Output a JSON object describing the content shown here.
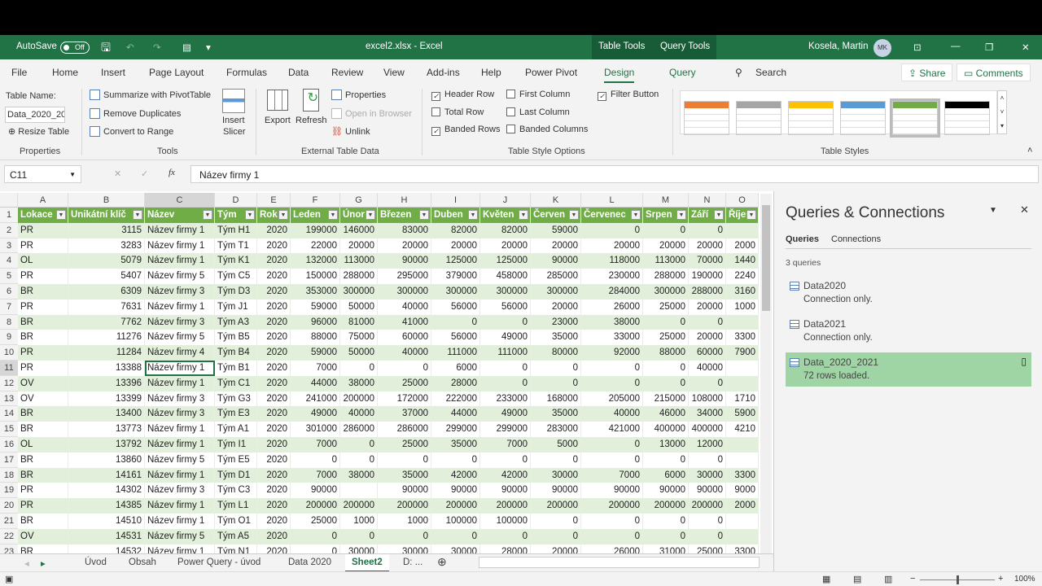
{
  "titlebar": {
    "autosave": "AutoSave",
    "toggle": "Off",
    "filename": "excel2.xlsx  -  Excel",
    "ctx1": "Table Tools",
    "ctx2": "Query Tools",
    "user": "Kosela, Martin",
    "initials": "MK"
  },
  "menu": {
    "tabs": [
      "File",
      "Home",
      "Insert",
      "Page Layout",
      "Formulas",
      "Data",
      "Review",
      "View",
      "Add-ins",
      "Help",
      "Power Pivot",
      "Design",
      "Query"
    ],
    "active": "Design",
    "search": "Search",
    "share": "Share",
    "comments": "Comments"
  },
  "ribbon": {
    "properties": {
      "label": "Table Name:",
      "value": "Data_2020_202",
      "resize": "Resize Table",
      "group": "Properties"
    },
    "tools": {
      "pivot": "Summarize with PivotTable",
      "dupes": "Remove Duplicates",
      "convert": "Convert to Range",
      "slicer1": "Insert",
      "slicer2": "Slicer",
      "group": "Tools"
    },
    "external": {
      "export": "Export",
      "refresh": "Refresh",
      "properties": "Properties",
      "browser": "Open in Browser",
      "unlink": "Unlink",
      "group": "External Table Data"
    },
    "options": {
      "header_row": "Header Row",
      "total_row": "Total Row",
      "banded_rows": "Banded Rows",
      "first_col": "First Column",
      "last_col": "Last Column",
      "banded_cols": "Banded Columns",
      "filter": "Filter Button",
      "group": "Table Style Options",
      "checked": {
        "header_row": true,
        "total_row": false,
        "banded_rows": true,
        "first_col": false,
        "last_col": false,
        "banded_cols": false,
        "filter": true
      }
    },
    "styles": {
      "group": "Table Styles",
      "colors": [
        "#ed7d31",
        "#a5a5a5",
        "#ffc000",
        "#5b9bd5",
        "#70ad47",
        "#000000"
      ],
      "selected": 4
    }
  },
  "formula": {
    "cellref": "C11",
    "fx": "fx",
    "value": "Název firmy 1"
  },
  "grid": {
    "columns": [
      "A",
      "B",
      "C",
      "D",
      "E",
      "F",
      "G",
      "H",
      "I",
      "J",
      "K",
      "L",
      "M",
      "N",
      "O"
    ],
    "headers": [
      "Lokace",
      "Unikátní klíč",
      "Název",
      "Tým",
      "Rok",
      "Leden",
      "Únor",
      "Březen",
      "Duben",
      "Květen",
      "Červen",
      "Červenec",
      "Srpen",
      "Září",
      "Říjen"
    ],
    "rows": [
      [
        "PR",
        "3115",
        "Název firmy 1",
        "Tým H1",
        "2020",
        "199000",
        "146000",
        "83000",
        "82000",
        "82000",
        "59000",
        "0",
        "0",
        "0",
        ""
      ],
      [
        "PR",
        "3283",
        "Název firmy 1",
        "Tým T1",
        "2020",
        "22000",
        "20000",
        "20000",
        "20000",
        "20000",
        "20000",
        "20000",
        "20000",
        "20000",
        "2000"
      ],
      [
        "OL",
        "5079",
        "Název firmy 1",
        "Tým K1",
        "2020",
        "132000",
        "113000",
        "90000",
        "125000",
        "125000",
        "90000",
        "118000",
        "113000",
        "70000",
        "1440"
      ],
      [
        "PR",
        "5407",
        "Název firmy 5",
        "Tým C5",
        "2020",
        "150000",
        "288000",
        "295000",
        "379000",
        "458000",
        "285000",
        "230000",
        "288000",
        "190000",
        "2240"
      ],
      [
        "BR",
        "6309",
        "Název firmy 3",
        "Tým D3",
        "2020",
        "353000",
        "300000",
        "300000",
        "300000",
        "300000",
        "300000",
        "284000",
        "300000",
        "288000",
        "3160"
      ],
      [
        "PR",
        "7631",
        "Název firmy 1",
        "Tým J1",
        "2020",
        "59000",
        "50000",
        "40000",
        "56000",
        "56000",
        "20000",
        "26000",
        "25000",
        "20000",
        "1000"
      ],
      [
        "BR",
        "7762",
        "Název firmy 3",
        "Tým A3",
        "2020",
        "96000",
        "81000",
        "41000",
        "0",
        "0",
        "23000",
        "38000",
        "0",
        "0",
        ""
      ],
      [
        "BR",
        "11276",
        "Název firmy 5",
        "Tým B5",
        "2020",
        "88000",
        "75000",
        "60000",
        "56000",
        "49000",
        "35000",
        "33000",
        "25000",
        "20000",
        "3300"
      ],
      [
        "PR",
        "11284",
        "Název firmy 4",
        "Tým B4",
        "2020",
        "59000",
        "50000",
        "40000",
        "111000",
        "111000",
        "80000",
        "92000",
        "88000",
        "60000",
        "7900"
      ],
      [
        "PR",
        "13388",
        "Název firmy 1",
        "Tým B1",
        "2020",
        "7000",
        "0",
        "0",
        "6000",
        "0",
        "0",
        "0",
        "0",
        "40000",
        ""
      ],
      [
        "OV",
        "13396",
        "Název firmy 1",
        "Tým C1",
        "2020",
        "44000",
        "38000",
        "25000",
        "28000",
        "0",
        "0",
        "0",
        "0",
        "0",
        ""
      ],
      [
        "OV",
        "13399",
        "Název firmy 3",
        "Tým G3",
        "2020",
        "241000",
        "200000",
        "172000",
        "222000",
        "233000",
        "168000",
        "205000",
        "215000",
        "108000",
        "1710"
      ],
      [
        "BR",
        "13400",
        "Název firmy 3",
        "Tým E3",
        "2020",
        "49000",
        "40000",
        "37000",
        "44000",
        "49000",
        "35000",
        "40000",
        "46000",
        "34000",
        "5900"
      ],
      [
        "BR",
        "13773",
        "Název firmy 1",
        "Tým A1",
        "2020",
        "301000",
        "286000",
        "286000",
        "299000",
        "299000",
        "283000",
        "421000",
        "400000",
        "400000",
        "4210"
      ],
      [
        "OL",
        "13792",
        "Název firmy 1",
        "Tým I1",
        "2020",
        "7000",
        "0",
        "25000",
        "35000",
        "7000",
        "5000",
        "0",
        "13000",
        "12000",
        ""
      ],
      [
        "BR",
        "13860",
        "Název firmy 5",
        "Tým E5",
        "2020",
        "0",
        "0",
        "0",
        "0",
        "0",
        "0",
        "0",
        "0",
        "0",
        ""
      ],
      [
        "BR",
        "14161",
        "Název firmy 1",
        "Tým D1",
        "2020",
        "7000",
        "38000",
        "35000",
        "42000",
        "42000",
        "30000",
        "7000",
        "6000",
        "30000",
        "3300"
      ],
      [
        "PR",
        "14302",
        "Název firmy 3",
        "Tým C3",
        "2020",
        "90000",
        "",
        "90000",
        "90000",
        "90000",
        "90000",
        "90000",
        "90000",
        "90000",
        "9000"
      ],
      [
        "PR",
        "14385",
        "Název firmy 1",
        "Tým L1",
        "2020",
        "200000",
        "200000",
        "200000",
        "200000",
        "200000",
        "200000",
        "200000",
        "200000",
        "200000",
        "2000"
      ],
      [
        "BR",
        "14510",
        "Název firmy 1",
        "Tým O1",
        "2020",
        "25000",
        "1000",
        "1000",
        "100000",
        "100000",
        "0",
        "0",
        "0",
        "0",
        ""
      ],
      [
        "OV",
        "14531",
        "Název firmy 5",
        "Tým A5",
        "2020",
        "0",
        "0",
        "0",
        "0",
        "0",
        "0",
        "0",
        "0",
        "0",
        ""
      ],
      [
        "BR",
        "14532",
        "Název firmy 1",
        "Tým N1",
        "2020",
        "0",
        "30000",
        "30000",
        "30000",
        "28000",
        "20000",
        "26000",
        "31000",
        "25000",
        "3300"
      ]
    ],
    "selected_cell": "C11"
  },
  "sheets": {
    "tabs": [
      "Úvod",
      "Obsah",
      "Power Query - úvod",
      "Data 2020",
      "Sheet2",
      "D: ..."
    ],
    "active": "Sheet2"
  },
  "pane": {
    "title": "Queries & Connections",
    "tabs": [
      "Queries",
      "Connections"
    ],
    "count": "3 queries",
    "queries": [
      {
        "name": "Data2020",
        "status": "Connection only."
      },
      {
        "name": "Data2021",
        "status": "Connection only."
      },
      {
        "name": "Data_2020_2021",
        "status": "72 rows loaded."
      }
    ],
    "active_query": 2
  },
  "status": {
    "zoom": "100%"
  }
}
